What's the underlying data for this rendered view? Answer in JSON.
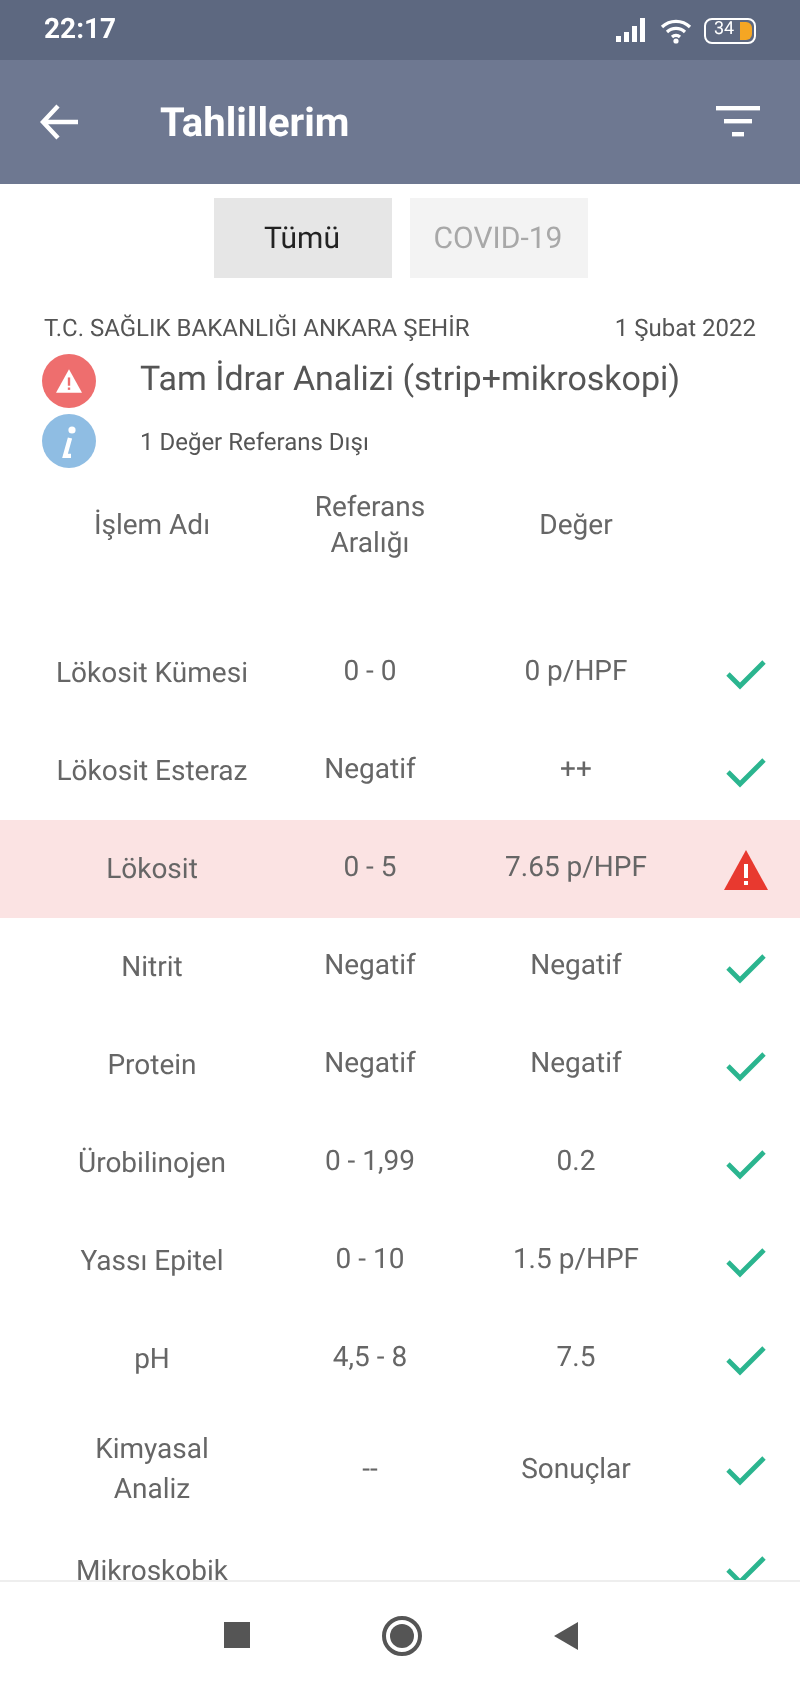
{
  "status_bar": {
    "time": "22:17",
    "battery": "34"
  },
  "app_bar": {
    "title": "Tahlillerim"
  },
  "tabs": [
    {
      "label": "Tümü",
      "selected": true
    },
    {
      "label": "COVID-19",
      "selected": false
    }
  ],
  "report": {
    "institution": "T.C. SAĞLIK BAKANLIĞI ANKARA ŞEHİR",
    "date": "1 Şubat 2022",
    "title": "Tam İdrar Analizi (strip+mikroskopi)",
    "note": "1 Değer Referans Dışı"
  },
  "table": {
    "columns": [
      "İşlem Adı",
      "Referans Aralığı",
      "Değer"
    ],
    "rows": [
      {
        "name": "Lökosit Kümesi",
        "reference": "0 - 0",
        "value": "0 p/HPF",
        "out_of_range": false
      },
      {
        "name": "Lökosit Esteraz",
        "reference": "Negatif",
        "value": "++",
        "out_of_range": false
      },
      {
        "name": "Lökosit",
        "reference": "0 - 5",
        "value": "7.65 p/HPF",
        "out_of_range": true
      },
      {
        "name": "Nitrit",
        "reference": "Negatif",
        "value": "Negatif",
        "out_of_range": false
      },
      {
        "name": "Protein",
        "reference": "Negatif",
        "value": "Negatif",
        "out_of_range": false
      },
      {
        "name": "Ürobilinojen",
        "reference": "0 - 1,99",
        "value": "0.2",
        "out_of_range": false
      },
      {
        "name": "Yassı Epitel",
        "reference": "0 - 10",
        "value": "1.5 p/HPF",
        "out_of_range": false
      },
      {
        "name": "pH",
        "reference": "4,5 - 8",
        "value": "7.5",
        "out_of_range": false
      },
      {
        "name": "Kimyasal Analiz",
        "reference": "--",
        "value": "Sonuçlar",
        "out_of_range": false
      },
      {
        "name": "Mikroskobik",
        "out_of_range": false
      }
    ]
  }
}
